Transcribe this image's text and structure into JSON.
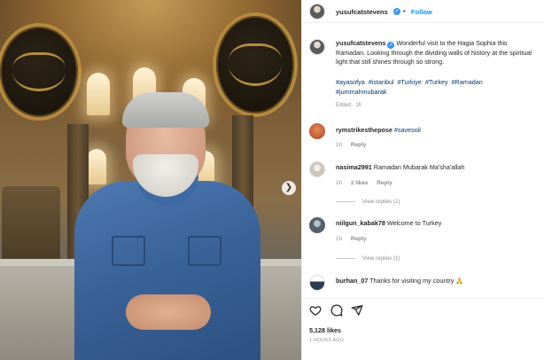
{
  "post": {
    "username": "yusufcatstevens",
    "follow_label": "Follow",
    "separator": "•",
    "caption_text": "Wonderful visit to the Hagia Sophia this Ramadan. Looking through the dividing walls of history at the spiritual light that still shines through so strong.",
    "hashtags": [
      "#ayasofya",
      "#istanbul",
      "#Turkiye",
      "#Turkey",
      "#Ramadan",
      "#jummahmubarak"
    ],
    "caption_meta": "Edited · 1h",
    "likes": "5,128 likes",
    "time_ago": "1 HOURS AGO"
  },
  "comments": [
    {
      "user": "rymstrikesthepose",
      "text": "",
      "tag": "#savesoil",
      "time": "1h",
      "likes": "",
      "reply": "Reply",
      "view_replies": ""
    },
    {
      "user": "nasima2991",
      "text": "Ramadan Mubarak Ma'sha'allah",
      "tag": "",
      "time": "1h",
      "likes": "2 likes",
      "reply": "Reply",
      "view_replies": "View replies (1)"
    },
    {
      "user": "niilgun_kabak78",
      "text": "Welcome to Turkey",
      "tag": "",
      "time": "1h",
      "likes": "",
      "reply": "Reply",
      "view_replies": "View replies (1)"
    },
    {
      "user": "burhan_07",
      "text": "Thanks for visiting my country 🙏",
      "tag": "",
      "time": "",
      "likes": "",
      "reply": "",
      "view_replies": ""
    }
  ],
  "icons": {
    "carousel_next": "chevron-right-icon",
    "verified": "verified-badge-icon",
    "like": "heart-icon",
    "comment": "comment-icon",
    "share": "share-icon"
  },
  "colors": {
    "link_blue": "#0095f6",
    "hashtag_blue": "#00376b",
    "verified_blue": "#3897f0",
    "meta_gray": "#8e8e8e"
  }
}
